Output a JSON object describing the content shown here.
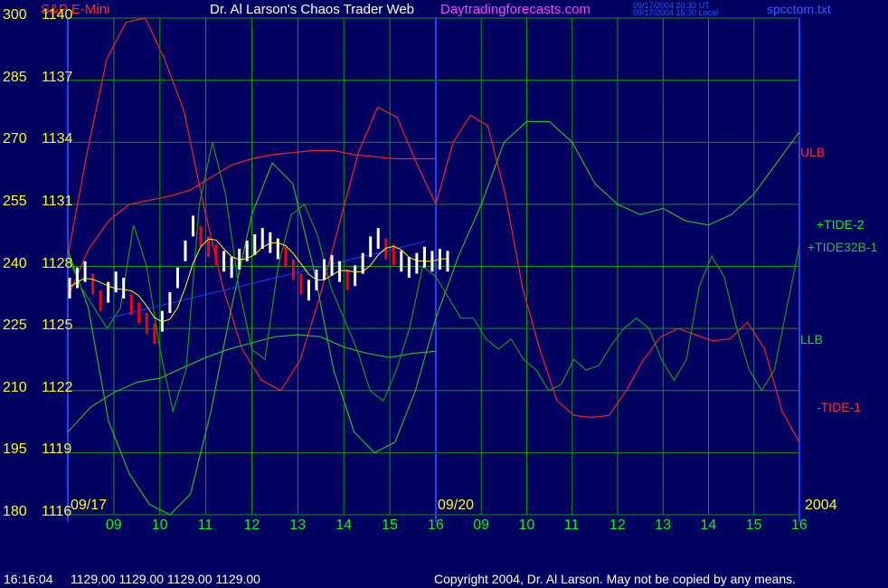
{
  "header": {
    "chart_name": "S&P E-Mini",
    "site_title": "Dr. Al Larson's Chaos Trader Web",
    "site_url": "Daytradingforecasts.com",
    "timestamp_ut": "09/17/2004 20:30 UT",
    "timestamp_local": "09/17/2004 15:30 Local",
    "filename": "spcctom.txt",
    "colors": {
      "chart_name": "#ff3030",
      "site_title": "#ffffff",
      "site_url": "#ff40ff",
      "timestamps": "#2060ff",
      "filename": "#3060ff"
    }
  },
  "footer": {
    "time": "16:16:04",
    "ohlc": "1129.00 1129.00 1129.00 1129.00",
    "copyright": "Copyright 2004, Dr. Al Larson. May not be copied by any means."
  },
  "chart_data": {
    "type": "line",
    "y_left_ticks": [
      "300",
      "285",
      "270",
      "255",
      "240",
      "225",
      "210",
      "195",
      "180"
    ],
    "y_price_ticks": [
      "1140",
      "1137",
      "1134",
      "1131",
      "1128",
      "1125",
      "1122",
      "1119",
      "1116"
    ],
    "ylim": [
      180,
      300
    ],
    "price_range": [
      1116,
      1140
    ],
    "x_hour_labels": [
      "09",
      "10",
      "11",
      "12",
      "13",
      "14",
      "15",
      "16",
      "09",
      "10",
      "11",
      "12",
      "13",
      "14",
      "15",
      "16"
    ],
    "date_labels": [
      "09/17",
      "09/20",
      "2004"
    ],
    "series_labels": [
      {
        "name": "ULB",
        "color": "#ff3030"
      },
      {
        "name": "+TIDE-2",
        "color": "#00ff00"
      },
      {
        "name": "+TIDE32B-1",
        "color": "#30c030"
      },
      {
        "name": "LLB",
        "color": "#30d030"
      },
      {
        "name": "-TIDE-1",
        "color": "#ff3030"
      }
    ],
    "colors": {
      "grid": "#00a000",
      "divider": "#2040ff",
      "price_up": "#ffffff",
      "price_down": "#ff0000",
      "average": "#ffff00",
      "trend": "#2040ff"
    },
    "price_bars_0917": [
      1127,
      1127.5,
      1127.8,
      1127.2,
      1126.4,
      1126.8,
      1127.3,
      1127.0,
      1126.2,
      1125.8,
      1125.3,
      1124.8,
      1125.4,
      1126.3,
      1127.5,
      1128.8,
      1130.0,
      1129.5,
      1129.0,
      1128.6,
      1128.3,
      1128.0,
      1128.4,
      1128.8,
      1129.1,
      1129.4,
      1129.2,
      1128.9,
      1128.5,
      1127.9,
      1127.2,
      1126.9,
      1127.4,
      1127.9,
      1128.1,
      1127.8,
      1127.4,
      1127.6,
      1128.2,
      1129.0,
      1129.4,
      1128.9,
      1128.6,
      1128.3,
      1128.0,
      1128.2,
      1128.5,
      1128.3,
      1128.4,
      1128.3
    ],
    "tide2_0917": [
      1128.5,
      1127.0,
      1126.0,
      1125.0,
      1126.0,
      1130.0,
      1128.0,
      1124.0,
      1121.0,
      1123.0,
      1131.0,
      1134.0,
      1131.5,
      1127.0,
      1124.0,
      1123.5,
      1128.0,
      1130.5,
      1131.0,
      1129.5,
      1127.0,
      1125.5,
      1124.0,
      1122.0,
      1121.5,
      1123.0,
      1125.0,
      1128.0,
      1127.5
    ],
    "tide2_0920": [
      1127.5,
      1126.5,
      1125.5,
      1125.5,
      1124.5,
      1124.0,
      1124.5,
      1123.5,
      1123.0,
      1122.0,
      1122.3,
      1123.5,
      1123.0,
      1123.2,
      1124.2,
      1125.0,
      1125.5,
      1125.0,
      1123.5,
      1122.5,
      1123.5,
      1127.0,
      1128.5,
      1127.5,
      1125.0,
      1123.0,
      1122.0,
      1123.0,
      1126.0,
      1129.0
    ],
    "tide32b_0917": [
      1128.8,
      1126.0,
      1120.5,
      1118.0,
      1116.5,
      1116.0,
      1117.0,
      1121.0,
      1126.0,
      1130.5,
      1133.0,
      1132.0,
      1128.0,
      1123.0,
      1120.0,
      1119.0,
      1119.5,
      1122.0,
      1125.5
    ],
    "tide32b_0920": [
      1125.5,
      1128.5,
      1131.0,
      1134.0,
      1135.0,
      1135.0,
      1134.0,
      1132.0,
      1131.0,
      1130.5,
      1130.8,
      1130.2,
      1130.0,
      1130.5,
      1131.5,
      1133.0,
      1134.5
    ],
    "ulb_0917": [
      1126.5,
      1128.8,
      1130.2,
      1131.0,
      1131.2,
      1131.4,
      1131.7,
      1132.3,
      1132.9,
      1133.2,
      1133.4,
      1133.5,
      1133.6,
      1133.6,
      1133.4,
      1133.3,
      1133.2,
      1133.2,
      1133.2
    ],
    "llb_0917": [
      1120.0,
      1121.2,
      1121.9,
      1122.4,
      1122.6,
      1123.1,
      1123.6,
      1124.0,
      1124.3,
      1124.6,
      1124.7,
      1124.6,
      1124.1,
      1123.8,
      1123.6,
      1123.8,
      1123.9
    ],
    "tide1_0917": [
      1128.5,
      1133.5,
      1138.0,
      1139.8,
      1140.0,
      1138.0,
      1135.5,
      1131.0,
      1127.0,
      1124.0,
      1122.5,
      1122.0,
      1123.5,
      1126.5,
      1130.0,
      1133.5,
      1135.7,
      1135.2,
      1133.0,
      1131.0
    ],
    "tide1_0920": [
      1131.0,
      1134.0,
      1135.3,
      1134.8,
      1131.5,
      1127.0,
      1124.0,
      1121.5,
      1120.8,
      1120.7,
      1120.8,
      1122.0,
      1123.5,
      1124.6,
      1125.0,
      1124.7,
      1124.4,
      1124.5,
      1125.3,
      1124.0,
      1121.0,
      1119.5
    ]
  }
}
